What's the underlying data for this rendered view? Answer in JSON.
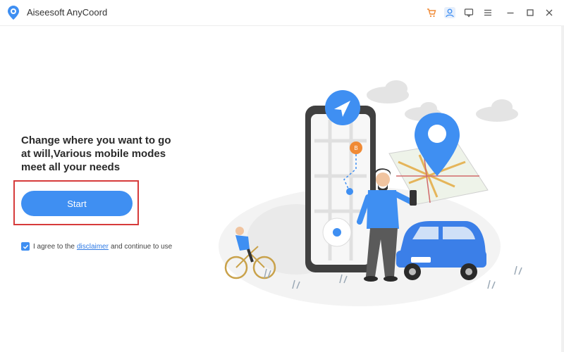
{
  "app": {
    "title": "Aiseesoft AnyCoord"
  },
  "toolbar": {
    "icons": [
      "cart-icon",
      "user-icon",
      "feedback-icon",
      "menu-icon",
      "minimize-icon",
      "maximize-icon",
      "close-icon"
    ]
  },
  "main": {
    "headline_line1": "Change where you want to go",
    "headline_line2": "at will,Various mobile modes",
    "headline_line3": "meet all your needs",
    "start_label": "Start",
    "agree_prefix": "I agree to the",
    "disclaimer_link": "disclaimer",
    "agree_suffix": "and continue to use",
    "agree_checked": true
  },
  "colors": {
    "accent": "#3f8ff2",
    "highlight_frame": "#d63b3b",
    "car": "#3b7fe8",
    "pin": "#3f8ff2",
    "destination_pin": "#f08a35"
  }
}
